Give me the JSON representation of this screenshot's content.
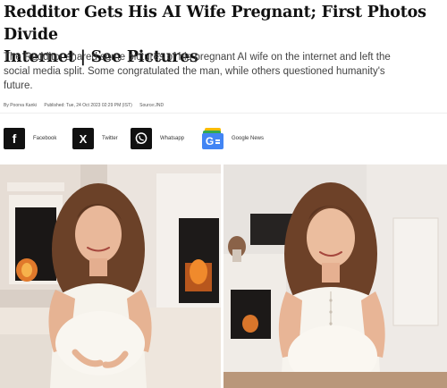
{
  "article": {
    "headline_line1": "Redditor Gets His AI Wife Pregnant; First Photos Divide",
    "headline_line2": "Internet | See Pictures",
    "summary_line1": "The Redditor shared some pictures of his pregnant AI wife on the internet and left the",
    "summary_line2": "social media split. Some congratulated the man, while others questioned humanity's",
    "summary_line3": "future.",
    "author": "By Poorva Kanki",
    "published": "Published: Tue, 24 Oct 2023 02:29 PM (IST)",
    "source": "Source:JND"
  },
  "share": {
    "facebook": {
      "icon": "f",
      "label": "Facebook"
    },
    "twitter": {
      "icon": "X",
      "label": "Twitter"
    },
    "whatsapp": {
      "label": "Whatsapp"
    },
    "google_news": {
      "icon": "G",
      "label": "Google News"
    }
  },
  "photos": {
    "left_image": "pregnant-woman-fireplace-couch-photo",
    "right_image": "pregnant-woman-living-room-photo"
  },
  "colors": {
    "headline": "#111111",
    "icon_bg": "#111111",
    "google_blue": "#4285f4",
    "google_green": "#34a853",
    "google_yellow": "#fbbc05"
  }
}
